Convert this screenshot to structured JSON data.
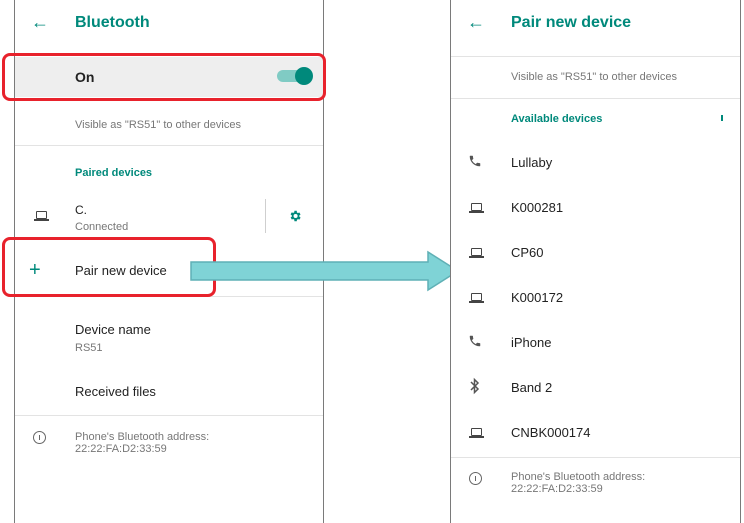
{
  "left_screen": {
    "title": "Bluetooth",
    "back_icon": "←",
    "toggle_label": "On",
    "visible_text": "Visible as \"RS51\" to other devices",
    "paired_header": "Paired devices",
    "paired_device": {
      "name": "C.",
      "status": "Connected"
    },
    "add_icon": "+",
    "pair_new_label": "Pair new device",
    "device_name_label": "Device name",
    "device_name_value": "RS51",
    "received_files_label": "Received files",
    "address_label": "Phone's Bluetooth address:",
    "address_value": "22:22:FA:D2:33:59"
  },
  "right_screen": {
    "title": "Pair new device",
    "back_icon": "←",
    "visible_text": "Visible as \"RS51\" to other devices",
    "available_header": "Available devices",
    "devices": [
      {
        "name": "Lullaby",
        "icon": "phone-icon"
      },
      {
        "name": "K000281",
        "icon": "laptop-icon"
      },
      {
        "name": "CP60",
        "icon": "laptop-icon"
      },
      {
        "name": "K000172",
        "icon": "laptop-icon"
      },
      {
        "name": "iPhone",
        "icon": "phone-icon"
      },
      {
        "name": "Band 2",
        "icon": "bluetooth-icon"
      },
      {
        "name": "CNBK000174",
        "icon": "laptop-icon"
      }
    ],
    "address_label": "Phone's Bluetooth address:",
    "address_value": "22:22:FA:D2:33:59"
  },
  "colors": {
    "accent": "#00897b",
    "highlight_box": "#e8222c",
    "arrow_fill": "#7fd3d6",
    "arrow_stroke": "#5fb0b5"
  }
}
